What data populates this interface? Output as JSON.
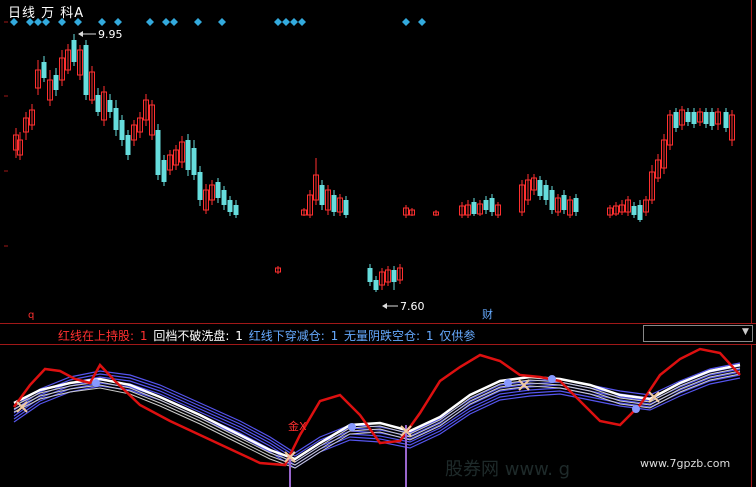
{
  "header": {
    "title": "日线 万 科A"
  },
  "main_chart": {
    "high_label": "9.95",
    "low_label": "7.60",
    "bottom_left_mark": "q",
    "bottom_mid_mark": "财"
  },
  "indicator_bar": {
    "items": [
      {
        "label": "红线在上持股:",
        "value": "1"
      },
      {
        "label": "回档不破洗盘:",
        "value": "1"
      },
      {
        "label": "红线下穿减仓:",
        "value": "1"
      },
      {
        "label": "无量阴跌空仓:",
        "value": "1"
      },
      {
        "label": "仅供参",
        "value": ""
      }
    ]
  },
  "sub_chart": {
    "gold_label": "金X"
  },
  "watermark": {
    "text1": "股券网 www. g",
    "text2": "www.7gpzb.com"
  },
  "colors": {
    "up": "#ff3030",
    "down": "#66dddd",
    "diamond": "#33aadd",
    "red_line": "#dd1010",
    "blue_line": "#5555ee"
  }
}
